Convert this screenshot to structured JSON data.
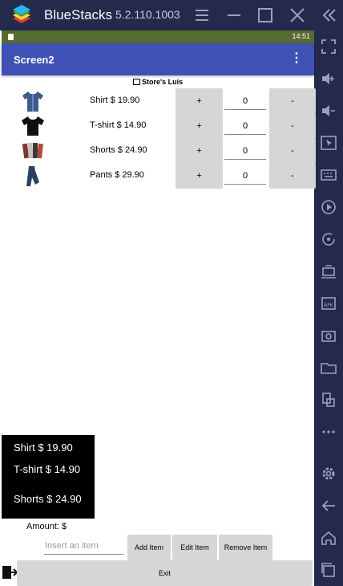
{
  "titlebar": {
    "app_name": "BlueStacks",
    "version": "5.2.110.1003"
  },
  "statusbar": {
    "time": "14:51"
  },
  "appbar": {
    "title": "Screen2"
  },
  "store": {
    "name": "Store's Luis"
  },
  "products": [
    {
      "label": "Shirt $ 19.90",
      "plus": "+",
      "qty": "0",
      "minus": "-",
      "color": "#3F5A8C"
    },
    {
      "label": "T-shirt $ 14.90",
      "plus": "+",
      "qty": "0",
      "minus": "-",
      "color": "#111111"
    },
    {
      "label": "Shorts $ 24.90",
      "plus": "+",
      "qty": "0",
      "minus": "-",
      "color": "#7a3b2e"
    },
    {
      "label": "Pants $ 29.90",
      "plus": "+",
      "qty": "0",
      "minus": "-",
      "color": "#2c3e62"
    }
  ],
  "cart_list": [
    "Shirt $ 19.90",
    "T-shirt $ 14.90",
    "Shorts $ 24.90"
  ],
  "amount_label": "Amount: $",
  "item_input": {
    "placeholder": "Insert an item",
    "value": ""
  },
  "buttons": {
    "add": "Add Item",
    "edit": "Edit Item",
    "remove": "Remove Item",
    "exit": "Exit"
  },
  "colors": {
    "titlebar": "#232A4B",
    "statusbar": "#556B2F",
    "appbar": "#3F51B5",
    "button": "#D6D6D6"
  },
  "sidebar_icons": [
    "fullscreen-icon",
    "volume-up-icon",
    "volume-down-icon",
    "pointer-icon",
    "keyboard-icon",
    "record-icon",
    "rotate-icon",
    "macro-icon",
    "apk-icon",
    "screenshot-icon",
    "folder-icon",
    "multi-instance-icon",
    "more-icon",
    "settings-icon",
    "back-icon",
    "home-icon",
    "recents-icon"
  ]
}
